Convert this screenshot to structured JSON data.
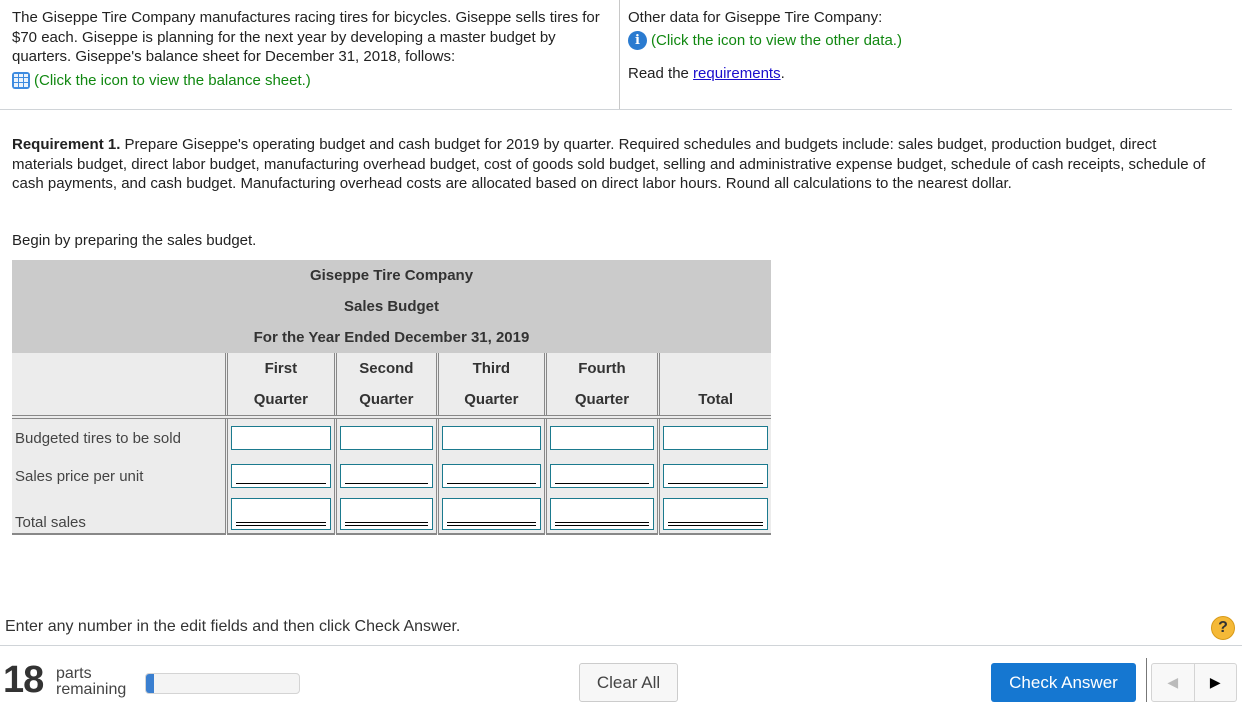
{
  "intro": {
    "text": "The Giseppe Tire Company manufactures racing tires for bicycles. Giseppe sells tires for $70 each. Giseppe is planning for the next year by developing a master budget by quarters. Giseppe's balance sheet for December 31, 2018, follows:",
    "balance_sheet_link": "(Click the icon to view the balance sheet.)"
  },
  "other": {
    "title": "Other data for Giseppe Tire Company:",
    "other_data_link": "(Click the icon to view the other data.)",
    "read_prefix": "Read the ",
    "requirements_link": "requirements",
    "read_suffix": "."
  },
  "requirement": {
    "label": "Requirement 1.",
    "text": " Prepare Giseppe's operating budget and cash budget for 2019 by quarter. Required schedules and budgets include: sales budget, production budget, direct materials budget, direct labor budget, manufacturing overhead budget, cost of goods sold budget, selling and administrative expense budget, schedule of cash receipts, schedule of cash payments, and cash budget. Manufacturing overhead costs are allocated based on direct labor hours. Round all calculations to the nearest dollar."
  },
  "begin": "Begin by preparing the sales budget.",
  "budget": {
    "company": "Giseppe Tire Company",
    "title": "Sales Budget",
    "period": "For the Year Ended December 31, 2019",
    "columns": [
      {
        "line1": "First",
        "line2": "Quarter"
      },
      {
        "line1": "Second",
        "line2": "Quarter"
      },
      {
        "line1": "Third",
        "line2": "Quarter"
      },
      {
        "line1": "Fourth",
        "line2": "Quarter"
      },
      {
        "line1": "",
        "line2": "Total"
      }
    ],
    "rows": [
      {
        "label": "Budgeted tires to be sold",
        "values": [
          "",
          "",
          "",
          "",
          ""
        ]
      },
      {
        "label": "Sales price per unit",
        "values": [
          "",
          "",
          "",
          "",
          ""
        ]
      },
      {
        "label": "Total sales",
        "values": [
          "",
          "",
          "",
          "",
          ""
        ]
      }
    ]
  },
  "footer": {
    "instruction": "Enter any number in the edit fields and then click Check Answer.",
    "help": "?",
    "parts_count": "18",
    "parts_line1": "parts",
    "parts_line2": "remaining",
    "progress_fraction": 0.05,
    "clear_all": "Clear All",
    "check_answer": "Check Answer",
    "prev": "◀",
    "next": "▶"
  }
}
